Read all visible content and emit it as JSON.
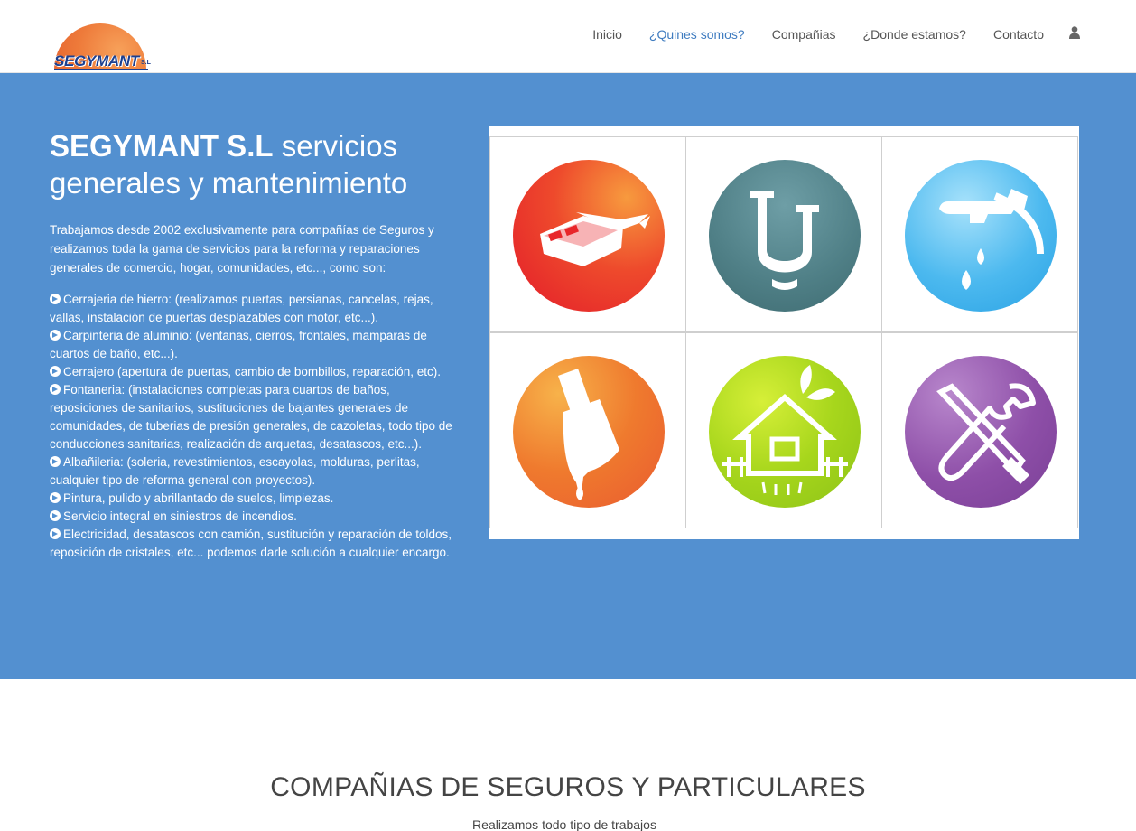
{
  "header": {
    "logo_text": "SEGYMANT",
    "logo_suffix": "S.L",
    "nav": [
      {
        "label": "Inicio",
        "active": false
      },
      {
        "label": "¿Quines somos?",
        "active": true
      },
      {
        "label": "Compañias",
        "active": false
      },
      {
        "label": "¿Donde estamos?",
        "active": false
      },
      {
        "label": "Contacto",
        "active": false
      }
    ],
    "user_icon": "user-icon"
  },
  "hero": {
    "title_brand": "SEGYMANT S.L",
    "title_rest": " servicios generales y mantenimiento",
    "intro": "Trabajamos desde 2002 exclusivamente para compañías de Seguros y realizamos toda la gama de servicios para la reforma y reparaciones generales de comercio, hogar, comunidades, etc..., como son:",
    "services": [
      "Cerrajeria de hierro: (realizamos puertas, persianas, cancelas, rejas, vallas, instalación de puertas desplazables con motor, etc...).",
      "Carpinteria de aluminio: (ventanas, cierros, frontales, mamparas de cuartos de baño, etc...).",
      "Cerrajero (apertura de puertas, cambio de bombillos, reparación, etc).",
      "Fontaneria: (instalaciones completas para cuartos de baños, reposiciones de sanitarios, sustituciones de bajantes generales de comunidades, de tuberias de presión generales, de cazoletas, todo tipo de conducciones sanitarias, realización de arquetas, desatascos, etc...).",
      "Albañileria: (soleria, revestimientos, escayolas, molduras, perlitas, cualquier tipo de reforma general con proyectos).",
      "Pintura, pulido y abrillantado de suelos, limpiezas.",
      "Servicio integral en siniestros de incendios.",
      "Electricidad, desatascos con camión, sustitución y reparación de toldos, reposición de cristales, etc... podemos darle solución a cualquier encargo."
    ],
    "service_icon": "arrow-circle-right-icon",
    "icons": [
      "brick-trowel-icon",
      "pipe-icon",
      "faucet-icon",
      "paint-brush-icon",
      "house-garden-icon",
      "tools-icon"
    ],
    "colors": {
      "background": "#5390d0",
      "brick": "#e8262a",
      "pipe": "#4f7f86",
      "faucet": "#4cb9ef",
      "brush": "#ef7a2e",
      "garden": "#9fd11b",
      "tools": "#8e4fa8"
    }
  },
  "section": {
    "title": "COMPAÑIAS DE SEGUROS Y PARTICULARES",
    "subtitle": "Realizamos todo tipo de trabajos"
  }
}
